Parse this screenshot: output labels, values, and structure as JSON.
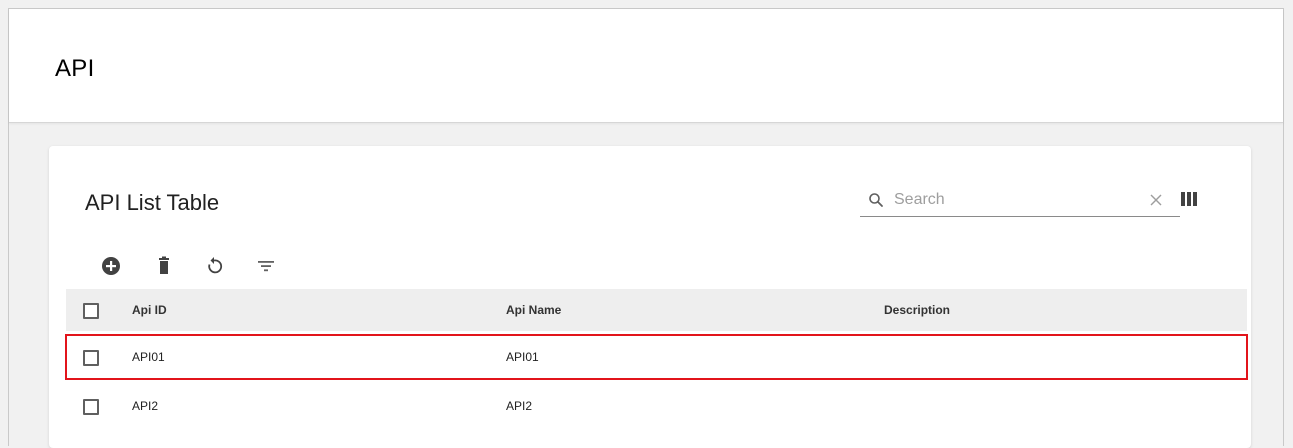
{
  "header": {
    "title": "API"
  },
  "card": {
    "title": "API List Table",
    "search": {
      "placeholder": "Search",
      "value": ""
    }
  },
  "toolbar": {
    "icons": [
      "add-circle-icon",
      "delete-icon",
      "refresh-icon",
      "filter-icon"
    ]
  },
  "table": {
    "columns": [
      "Api ID",
      "Api Name",
      "Description"
    ],
    "rows": [
      {
        "id": "API01",
        "name": "API01",
        "description": "",
        "highlighted": true
      },
      {
        "id": "API2",
        "name": "API2",
        "description": "",
        "highlighted": false
      }
    ]
  },
  "colors": {
    "highlight_border": "#e2141b",
    "header_row_bg": "#eeeeee",
    "page_bg": "#f1f1f1"
  }
}
